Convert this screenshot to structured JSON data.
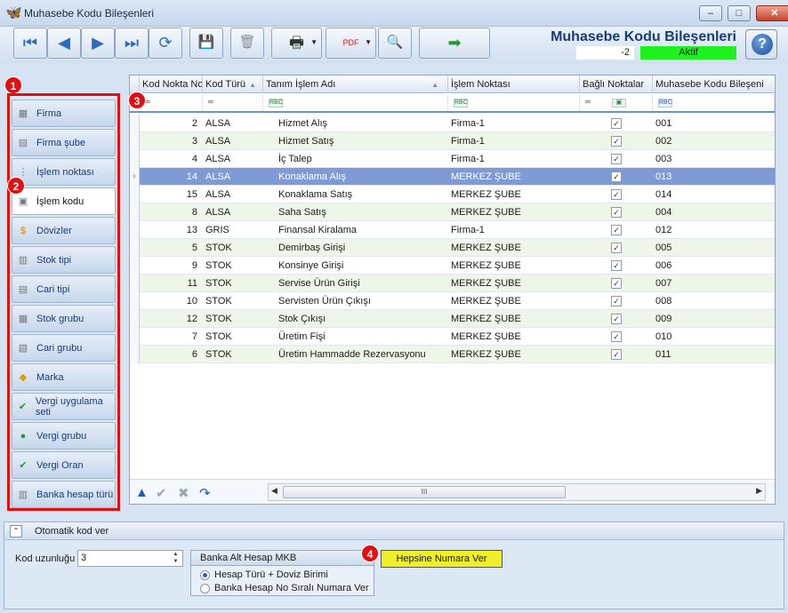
{
  "window": {
    "title": "Muhasebe Kodu Bileşenleri",
    "controls": [
      "–",
      "□",
      "✕"
    ]
  },
  "header": {
    "screen_title": "Muhasebe Kodu Bileşenleri",
    "record_id": "-2",
    "status": "Aktif",
    "status_color": "#1ef21e"
  },
  "toolbar": {
    "buttons": [
      {
        "name": "first-record-button",
        "icon": "first-icon",
        "glyph": "⏮"
      },
      {
        "name": "previous-record-button",
        "icon": "previous-icon",
        "glyph": "◀"
      },
      {
        "name": "next-record-button",
        "icon": "next-icon",
        "glyph": "▶"
      },
      {
        "name": "last-record-button",
        "icon": "last-icon",
        "glyph": "⏭"
      },
      {
        "name": "refresh-button",
        "icon": "refresh-icon",
        "glyph": "⟳"
      },
      {
        "name": "save-button",
        "icon": "save-icon",
        "glyph": "💾"
      },
      {
        "name": "delete-button",
        "icon": "delete-icon",
        "glyph": "🗑"
      },
      {
        "name": "print-button",
        "icon": "print-icon",
        "glyph": "🖶"
      },
      {
        "name": "export-pdf-button",
        "icon": "pdf-icon",
        "glyph": "PDF"
      },
      {
        "name": "search-button",
        "icon": "search-icon",
        "glyph": "🔍"
      },
      {
        "name": "exit-button",
        "icon": "exit-door-icon",
        "glyph": "➡"
      }
    ]
  },
  "badges": [
    "1",
    "2",
    "3",
    "4"
  ],
  "sidebar": {
    "items": [
      {
        "label": "Firma",
        "icon": "building-icon"
      },
      {
        "label": "Firma şube",
        "icon": "branch-icon"
      },
      {
        "label": "İşlem noktası",
        "icon": "process-point-icon"
      },
      {
        "label": "İşlem kodu",
        "icon": "process-code-icon",
        "active": true
      },
      {
        "label": "Dövizler",
        "icon": "currency-icon"
      },
      {
        "label": "Stok tipi",
        "icon": "stock-type-icon"
      },
      {
        "label": "Cari tipi",
        "icon": "account-type-icon"
      },
      {
        "label": "Stok grubu",
        "icon": "stock-group-icon"
      },
      {
        "label": "Cari grubu",
        "icon": "account-group-icon"
      },
      {
        "label": "Marka",
        "icon": "brand-tag-icon"
      },
      {
        "label": "Vergi uygulama seti",
        "icon": "tax-set-icon"
      },
      {
        "label": "Vergi grubu",
        "icon": "tax-group-icon"
      },
      {
        "label": "Vergi Oran",
        "icon": "tax-rate-icon"
      },
      {
        "label": "Banka hesap türü",
        "icon": "bank-icon"
      }
    ]
  },
  "grid": {
    "columns": [
      "Kod Nokta No",
      "Kod Türü",
      "Tanım İşlem Adı",
      "İşlem Noktası",
      "Bağlı Noktalar",
      "Muhasebe Kodu Bileşeni"
    ],
    "rows": [
      {
        "no": "2",
        "tur": "ALSA",
        "ad": "Hizmet Alış",
        "nokta": "Firma-1",
        "bagli": true,
        "kod": "001"
      },
      {
        "no": "3",
        "tur": "ALSA",
        "ad": "Hizmet Satış",
        "nokta": "Firma-1",
        "bagli": true,
        "kod": "002"
      },
      {
        "no": "4",
        "tur": "ALSA",
        "ad": "İç Talep",
        "nokta": "Firma-1",
        "bagli": true,
        "kod": "003"
      },
      {
        "no": "14",
        "tur": "ALSA",
        "ad": "Konaklama Alış",
        "nokta": "MERKEZ ŞUBE",
        "bagli": true,
        "kod": "013",
        "selected": true
      },
      {
        "no": "15",
        "tur": "ALSA",
        "ad": "Konaklama Satış",
        "nokta": "MERKEZ ŞUBE",
        "bagli": true,
        "kod": "014"
      },
      {
        "no": "8",
        "tur": "ALSA",
        "ad": "Saha Satış",
        "nokta": "MERKEZ ŞUBE",
        "bagli": true,
        "kod": "004"
      },
      {
        "no": "13",
        "tur": "GRIS",
        "ad": "Finansal Kiralama",
        "nokta": "Firma-1",
        "bagli": true,
        "kod": "012"
      },
      {
        "no": "5",
        "tur": "STOK",
        "ad": "Demirbaş Girişi",
        "nokta": "MERKEZ ŞUBE",
        "bagli": true,
        "kod": "005"
      },
      {
        "no": "9",
        "tur": "STOK",
        "ad": "Konsinye Girişi",
        "nokta": "MERKEZ ŞUBE",
        "bagli": true,
        "kod": "006"
      },
      {
        "no": "11",
        "tur": "STOK",
        "ad": "Servise Ürün Girişi",
        "nokta": "MERKEZ ŞUBE",
        "bagli": true,
        "kod": "007"
      },
      {
        "no": "10",
        "tur": "STOK",
        "ad": "Servisten Ürün Çıkışı",
        "nokta": "MERKEZ ŞUBE",
        "bagli": true,
        "kod": "008"
      },
      {
        "no": "12",
        "tur": "STOK",
        "ad": "Stok Çıkışı",
        "nokta": "MERKEZ ŞUBE",
        "bagli": true,
        "kod": "009"
      },
      {
        "no": "7",
        "tur": "STOK",
        "ad": "Üretim Fişi",
        "nokta": "MERKEZ ŞUBE",
        "bagli": true,
        "kod": "010"
      },
      {
        "no": "6",
        "tur": "STOK",
        "ad": "Üretim Hammadde Rezervasyonu",
        "nokta": "MERKEZ ŞUBE",
        "bagli": true,
        "kod": "011"
      }
    ],
    "scroll_thumb": "III"
  },
  "bottom": {
    "panel_title": "Otomatik kod ver",
    "kod_label": "Kod uzunluğu",
    "kod_value": "3",
    "group_title": "Banka Alt Hesap MKB",
    "radio_options": [
      "Hesap Türü + Doviz Birimi",
      "Banka Hesap No Sıralı Numara Ver"
    ],
    "radio_selected": 0,
    "number_button": "Hepsine Numara Ver"
  }
}
